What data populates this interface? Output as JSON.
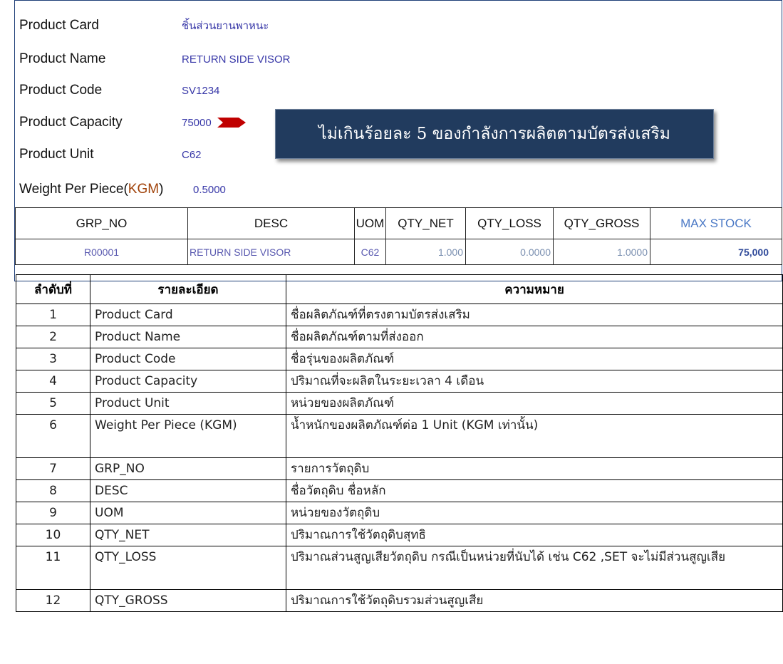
{
  "form": {
    "product_card": {
      "label": "Product Card",
      "value": "ชิ้นส่วนยานพาหนะ"
    },
    "product_name": {
      "label": "Product Name",
      "value": "RETURN SIDE VISOR"
    },
    "product_code": {
      "label": "Product Code",
      "value": "SV1234"
    },
    "product_capacity": {
      "label": "Product Capacity",
      "value": "75000"
    },
    "product_unit": {
      "label": "Product Unit",
      "value": "C62"
    },
    "weight_per_piece": {
      "label": "Weight Per Piece(",
      "unit": "KGM",
      "label_end": ")",
      "value": "0.5000"
    }
  },
  "callout": {
    "text": "ไม่เกินร้อยละ 5 ของกำลังการผลิตตามบัตรส่งเสริม"
  },
  "grid": {
    "headers": [
      "GRP_NO",
      "DESC",
      "UOM",
      "QTY_NET",
      "QTY_LOSS",
      "QTY_GROSS",
      "MAX STOCK"
    ],
    "row": [
      "R00001",
      "RETURN SIDE VISOR",
      "C62",
      "1.000",
      "0.0000",
      "1.0000",
      "75,000"
    ]
  },
  "meaning_table": {
    "headers": [
      "ลำดับที่",
      "รายละเอียด",
      "ความหมาย"
    ],
    "rows": [
      {
        "no": "1",
        "detail": "Product Card",
        "meaning": "ชื่อผลิตภัณฑ์ที่ตรงตามบัตรส่งเสริม"
      },
      {
        "no": "2",
        "detail": "Product Name",
        "meaning": "ชื่อผลิตภัณฑ์ตามที่ส่งออก"
      },
      {
        "no": "3",
        "detail": "Product Code",
        "meaning": "ชื่อรุ่นของผลิตภัณฑ์"
      },
      {
        "no": "4",
        "detail": "Product Capacity",
        "meaning": "ปริมาณที่จะผลิตในระยะเวลา 4 เดือน"
      },
      {
        "no": "5",
        "detail": "Product Unit",
        "meaning": "หน่วยของผลิตภัณฑ์"
      },
      {
        "no": "6",
        "detail": "Weight Per Piece (KGM)",
        "meaning": "น้ำหนักของผลิตภัณฑ์ต่อ 1 Unit (KGM เท่านั้น)"
      },
      {
        "no": "7",
        "detail": "GRP_NO",
        "meaning": "รายการวัตถุดิบ"
      },
      {
        "no": "8",
        "detail": "DESC",
        "meaning": "ชื่อวัตถุดิบ ชื่อหลัก"
      },
      {
        "no": "9",
        "detail": "UOM",
        "meaning": "หน่วยของวัตถุดิบ"
      },
      {
        "no": "10",
        "detail": "QTY_NET",
        "meaning": "ปริมาณการใช้วัตถุดิบสุทธิ"
      },
      {
        "no": "11",
        "detail": "QTY_LOSS",
        "meaning": "ปริมาณส่วนสูญเสียวัตถุดิบ กรณีเป็นหน่วยที่นับได้ เช่น C62 ,SET จะไม่มีส่วนสูญเสีย"
      },
      {
        "no": "12",
        "detail": "QTY_GROSS",
        "meaning": "ปริมาณการใช้วัตถุดิบรวมส่วนสูญเสีย"
      }
    ]
  },
  "colors": {
    "callout_bg": "#213b5e",
    "arrow": "#c00000",
    "value_text": "#3838a8",
    "max_stock_header": "#4a78c5"
  }
}
